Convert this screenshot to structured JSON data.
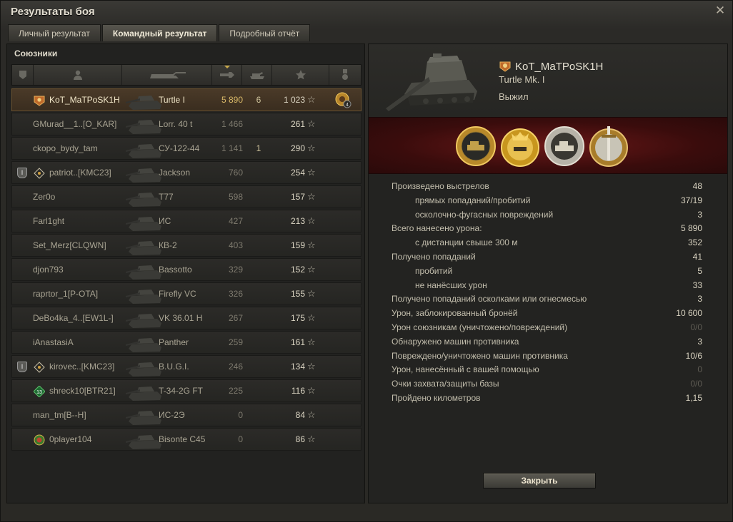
{
  "window": {
    "title": "Результаты боя"
  },
  "tabs": [
    {
      "label": "Личный результат"
    },
    {
      "label": "Командный результат",
      "active": true
    },
    {
      "label": "Подробный отчёт"
    }
  ],
  "allies": {
    "label": "Союзники",
    "rows": [
      {
        "player": "KoT_MaTPoSK1H",
        "tank": "Turtle I",
        "damage": "5 890",
        "kills": "6",
        "xp": "1 023",
        "self": true,
        "clan_icon": "orange-badge",
        "medal": "4"
      },
      {
        "player": "GMurad__1..[O_KAR]",
        "tank": "Lorr. 40 t",
        "damage": "1 466",
        "kills": "",
        "xp": "261"
      },
      {
        "player": "ckopo_bydy_tam",
        "tank": "СУ-122-44",
        "damage": "1 141",
        "kills": "1",
        "xp": "290"
      },
      {
        "player": "patriot..[KMC23]",
        "tank": "Jackson",
        "damage": "760",
        "kills": "",
        "xp": "254",
        "platoon": "I",
        "clan_icon": "diamond"
      },
      {
        "player": "Zer0o",
        "tank": "T77",
        "damage": "598",
        "kills": "",
        "xp": "157"
      },
      {
        "player": "Farl1ght",
        "tank": "ИС",
        "damage": "427",
        "kills": "",
        "xp": "213"
      },
      {
        "player": "Set_Merz[CLQWN]",
        "tank": "КВ-2",
        "damage": "403",
        "kills": "",
        "xp": "159"
      },
      {
        "player": "djon793",
        "tank": "Bassotto",
        "damage": "329",
        "kills": "",
        "xp": "152"
      },
      {
        "player": "raprtor_1[P-OTA]",
        "tank": "Firefly VC",
        "damage": "326",
        "kills": "",
        "xp": "155"
      },
      {
        "player": "DeBo4ka_4..[EW1L-]",
        "tank": "VK 36.01 H",
        "damage": "267",
        "kills": "",
        "xp": "175"
      },
      {
        "player": "iAnastasiA",
        "tank": "Panther",
        "damage": "259",
        "kills": "",
        "xp": "161"
      },
      {
        "player": "kirovec..[KMC23]",
        "tank": "B.U.G.I.",
        "damage": "246",
        "kills": "",
        "xp": "134",
        "platoon": "I",
        "clan_icon": "diamond"
      },
      {
        "player": "shreck10[BTR21]",
        "tank": "T-34-2G FT",
        "damage": "225",
        "kills": "",
        "xp": "116",
        "clan_icon": "green-badge",
        "clan_text": "13"
      },
      {
        "player": "man_tm[B--H]",
        "tank": "ИС-2Э",
        "damage": "0",
        "kills": "",
        "xp": "84"
      },
      {
        "player": "0player104",
        "tank": "Bisonte C45",
        "damage": "0",
        "kills": "",
        "xp": "86",
        "clan_icon": "green-gold-badge"
      }
    ]
  },
  "detail": {
    "player": "KoT_MaTPoSK1H",
    "tank": "Turtle Mk. I",
    "status": "Выжил",
    "stats": [
      {
        "label": "Произведено выстрелов",
        "value": "48"
      },
      {
        "label": "прямых попаданий/пробитий",
        "value": "37/19",
        "sub": true
      },
      {
        "label": "осколочно-фугасных повреждений",
        "value": "3",
        "sub": true
      },
      {
        "label": "Всего нанесено урона:",
        "value": "5 890"
      },
      {
        "label": "с дистанции свыше 300 м",
        "value": "352",
        "sub": true
      },
      {
        "label": "Получено попаданий",
        "value": "41"
      },
      {
        "label": "пробитий",
        "value": "5",
        "sub": true
      },
      {
        "label": "не нанёсших урон",
        "value": "33",
        "sub": true
      },
      {
        "label": "Получено попаданий осколками или огнесмесью",
        "value": "3"
      },
      {
        "label": "Урон, заблокированный бронёй",
        "value": "10 600"
      },
      {
        "label": "Урон союзникам (уничтожено/повреждений)",
        "value": "0/0",
        "dim": true
      },
      {
        "label": "Обнаружено машин противника",
        "value": "3"
      },
      {
        "label": "Повреждено/уничтожено машин противника",
        "value": "10/6"
      },
      {
        "label": "Урон, нанесённый с вашей помощью",
        "value": "0",
        "dim": true
      },
      {
        "label": "Очки захвата/защиты базы",
        "value": "0/0",
        "dim": true
      },
      {
        "label": "Пройдено километров",
        "value": "1,15"
      }
    ],
    "close_label": "Закрыть"
  }
}
